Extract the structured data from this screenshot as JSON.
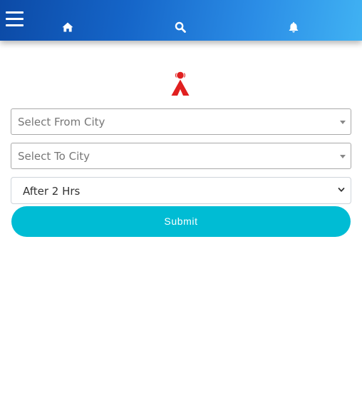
{
  "header": {
    "menu_icon": "hamburger-icon",
    "nav_icons": [
      "home-icon",
      "search-icon",
      "bell-icon"
    ],
    "gradient_colors": [
      "#0c4aa6",
      "#40b2f3"
    ]
  },
  "form": {
    "from_city_placeholder": "Select From City",
    "to_city_placeholder": "Select To City",
    "time_selected": "After 2 Hrs",
    "submit_label": "Submit"
  },
  "colors": {
    "accent": "#00bcd4",
    "logo_red": "#e02020"
  }
}
